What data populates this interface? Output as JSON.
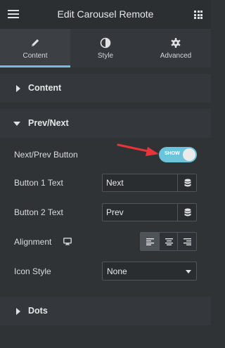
{
  "header": {
    "title": "Edit Carousel Remote"
  },
  "tabs": [
    {
      "label": "Content",
      "icon": "pencil-icon",
      "active": true
    },
    {
      "label": "Style",
      "icon": "half-circle-icon",
      "active": false
    },
    {
      "label": "Advanced",
      "icon": "gear-icon",
      "active": false
    }
  ],
  "sections": {
    "content": {
      "label": "Content"
    },
    "prevnext": {
      "label": "Prev/Next"
    },
    "dots": {
      "label": "Dots"
    }
  },
  "controls": {
    "nextprev_button": {
      "label": "Next/Prev Button",
      "toggle_text": "SHOW",
      "on": true
    },
    "button1_text": {
      "label": "Button 1 Text",
      "value": "Next"
    },
    "button2_text": {
      "label": "Button 2 Text",
      "value": "Prev"
    },
    "alignment": {
      "label": "Alignment",
      "options": [
        "left",
        "center",
        "right"
      ],
      "selected": "left"
    },
    "icon_style": {
      "label": "Icon Style",
      "value": "None"
    }
  },
  "colors": {
    "accent": "#6cc3dc",
    "annotation_arrow": "#e8343a",
    "panel_bg": "#303336",
    "section_bg": "#34383c"
  }
}
